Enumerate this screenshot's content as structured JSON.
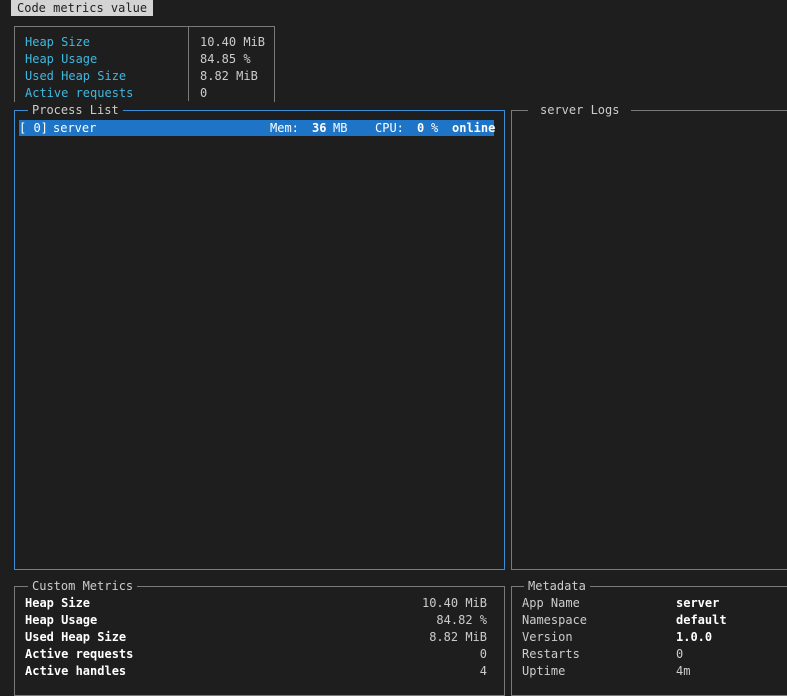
{
  "header": {
    "title": "Code metrics value"
  },
  "top_metrics": [
    {
      "key": "Heap Size",
      "value": "10.40 MiB"
    },
    {
      "key": "Heap Usage",
      "value": "84.85 %"
    },
    {
      "key": "Used Heap Size",
      "value": "8.82 MiB"
    },
    {
      "key": "Active requests",
      "value": "0"
    }
  ],
  "process_list": {
    "title": "Process List",
    "rows": [
      {
        "id": "[ 0]",
        "name": "server",
        "mem_label": "Mem:",
        "mem_value": "36",
        "mem_unit": "MB",
        "cpu_label": "CPU:",
        "cpu_value": "0",
        "cpu_unit": "%",
        "status": "online"
      }
    ]
  },
  "logs": {
    "title": "server Logs"
  },
  "custom_metrics": {
    "title": "Custom Metrics",
    "rows": [
      {
        "key": "Heap Size",
        "value": "10.40 MiB"
      },
      {
        "key": "Heap Usage",
        "value": "84.82 %"
      },
      {
        "key": "Used Heap Size",
        "value": "8.82 MiB"
      },
      {
        "key": "Active requests",
        "value": "0"
      },
      {
        "key": "Active handles",
        "value": "4"
      }
    ]
  },
  "metadata": {
    "title": "Metadata",
    "rows": [
      {
        "key": "App Name",
        "value": "server"
      },
      {
        "key": "Namespace",
        "value": "default"
      },
      {
        "key": "Version",
        "value": "1.0.0"
      },
      {
        "key": "Restarts",
        "value": "0"
      },
      {
        "key": "Uptime",
        "value": "4m"
      }
    ]
  }
}
